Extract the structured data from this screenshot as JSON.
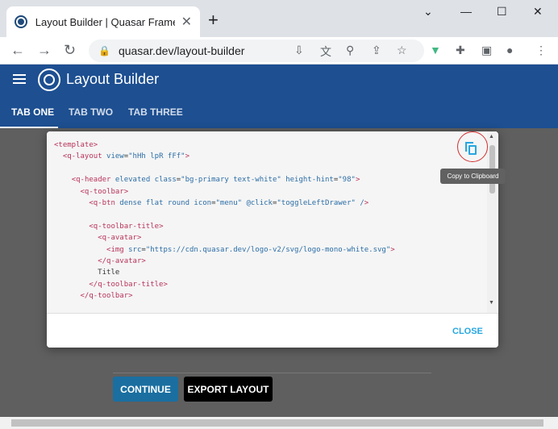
{
  "browser": {
    "tab_title": "Layout Builder | Quasar Framewo",
    "new_tab": "+",
    "url": "quasar.dev/layout-builder",
    "close_tab": "✕",
    "minimize": "—",
    "maximize": "☐",
    "close_window": "✕"
  },
  "app": {
    "title": "Layout Builder",
    "tabs": [
      {
        "label": "TAB ONE"
      },
      {
        "label": "TAB TWO"
      },
      {
        "label": "TAB THREE"
      }
    ],
    "continue_label": "CONTINUE",
    "export_label": "EXPORT LAYOUT",
    "colors": {
      "header": "#1d4f91",
      "accent": "#26a6e0",
      "continue": "#1976d2"
    }
  },
  "dialog": {
    "code_lines": [
      [
        "<template>"
      ],
      [
        "  <q-layout view=\"hHh lpR fFf\">"
      ],
      [
        ""
      ],
      [
        "    <q-header elevated class=\"bg-primary text-white\" height-hint=\"98\">"
      ],
      [
        "      <q-toolbar>"
      ],
      [
        "        <q-btn dense flat round icon=\"menu\" @click=\"toggleLeftDrawer\" />"
      ],
      [
        ""
      ],
      [
        "        <q-toolbar-title>"
      ],
      [
        "          <q-avatar>"
      ],
      [
        "            <img src=\"https://cdn.quasar.dev/logo-v2/svg/logo-mono-white.svg\">"
      ],
      [
        "          </q-avatar>"
      ],
      [
        "          Title"
      ],
      [
        "        </q-toolbar-title>"
      ],
      [
        "      </q-toolbar>"
      ]
    ],
    "tooltip": "Copy to Clipboard",
    "close_label": "CLOSE"
  }
}
